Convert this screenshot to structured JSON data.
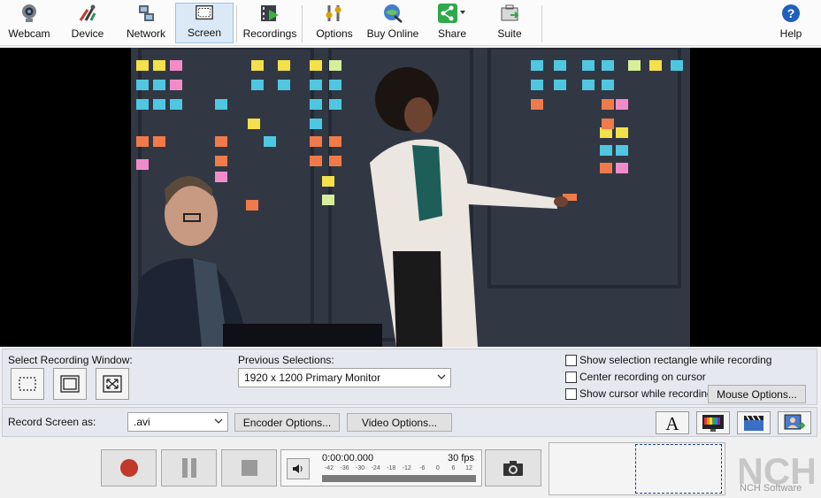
{
  "toolbar": {
    "items": [
      {
        "label": "Webcam",
        "icon": "webcam-icon"
      },
      {
        "label": "Device",
        "icon": "device-icon"
      },
      {
        "label": "Network",
        "icon": "network-icon"
      },
      {
        "label": "Screen",
        "icon": "screen-icon"
      },
      {
        "label": "Recordings",
        "icon": "recordings-icon"
      },
      {
        "label": "Options",
        "icon": "options-icon"
      },
      {
        "label": "Buy Online",
        "icon": "buy-online-icon"
      },
      {
        "label": "Share",
        "icon": "share-icon"
      },
      {
        "label": "Suite",
        "icon": "suite-icon"
      },
      {
        "label": "Help",
        "icon": "help-icon"
      }
    ],
    "active": "Screen"
  },
  "selection": {
    "window_label": "Select Recording Window:",
    "previous_label": "Previous Selections:",
    "previous_value": "1920 x 1200 Primary Monitor",
    "checkboxes": [
      {
        "label": "Show selection rectangle while recording",
        "checked": false
      },
      {
        "label": "Center recording on cursor",
        "checked": false
      },
      {
        "label": "Show cursor while recording",
        "checked": false
      }
    ],
    "mouse_options": "Mouse Options..."
  },
  "record": {
    "label": "Record Screen as:",
    "format": ".avi",
    "encoder_options": "Encoder Options...",
    "video_options": "Video Options..."
  },
  "transport": {
    "time": "0:00:00.000",
    "fps": "30 fps",
    "ticks": [
      "-42",
      "-36",
      "-30",
      "-24",
      "-18",
      "-12",
      "-6",
      "0",
      "6",
      "12"
    ]
  },
  "brand": {
    "logo_text": "NCH",
    "name": "NCH Software"
  },
  "colors": {
    "accent": "#dbe9f7",
    "record_red": "#c0392b",
    "panel": "#e6e8ef"
  }
}
